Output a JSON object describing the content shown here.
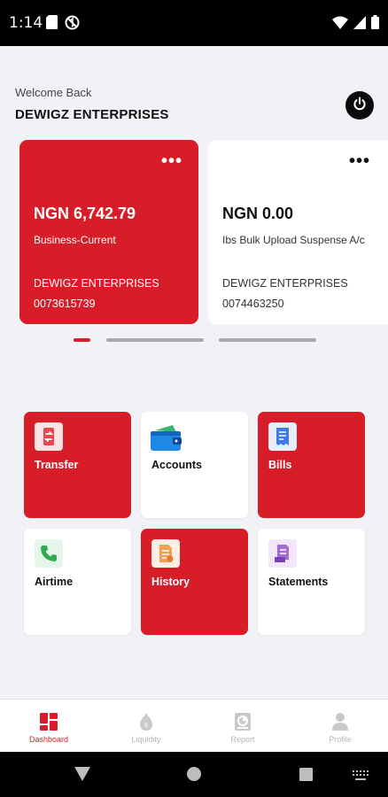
{
  "status_bar": {
    "time": "1:14",
    "left_icons": [
      "sd-card-icon",
      "no-data-icon"
    ],
    "right_icons": [
      "wifi-icon",
      "signal-icon",
      "battery-icon"
    ]
  },
  "header": {
    "welcome": "Welcome Back",
    "company": "DEWIGZ ENTERPRISES",
    "power_icon": "power-icon"
  },
  "accounts": [
    {
      "balance": "NGN 6,742.79",
      "type": "Business-Current",
      "holder": "DEWIGZ ENTERPRISES",
      "number": "0073615739",
      "menu": "•••"
    },
    {
      "balance": "NGN 0.00",
      "type": "Ibs Bulk Upload Suspense A/c",
      "holder": "DEWIGZ ENTERPRISES",
      "number": "0074463250",
      "menu": "•••"
    }
  ],
  "pager": {
    "count": 3,
    "active_index": 0
  },
  "tiles": [
    {
      "label": "Transfer",
      "icon": "transfer-icon"
    },
    {
      "label": "Accounts",
      "icon": "wallet-icon"
    },
    {
      "label": "Bills",
      "icon": "bill-icon"
    },
    {
      "label": "Airtime",
      "icon": "phone-icon"
    },
    {
      "label": "History",
      "icon": "history-document-icon"
    },
    {
      "label": "Statements",
      "icon": "statement-icon"
    }
  ],
  "bottom_nav": [
    {
      "label": "Dashboard",
      "icon": "dashboard-icon",
      "active": true
    },
    {
      "label": "Liquidity",
      "icon": "liquidity-icon",
      "active": false
    },
    {
      "label": "Report",
      "icon": "report-icon",
      "active": false
    },
    {
      "label": "Profile",
      "icon": "profile-icon",
      "active": false
    }
  ],
  "colors": {
    "brand_red": "#d71e28",
    "background": "#f1f2f6",
    "inactive_nav": "#b7b7b7"
  }
}
